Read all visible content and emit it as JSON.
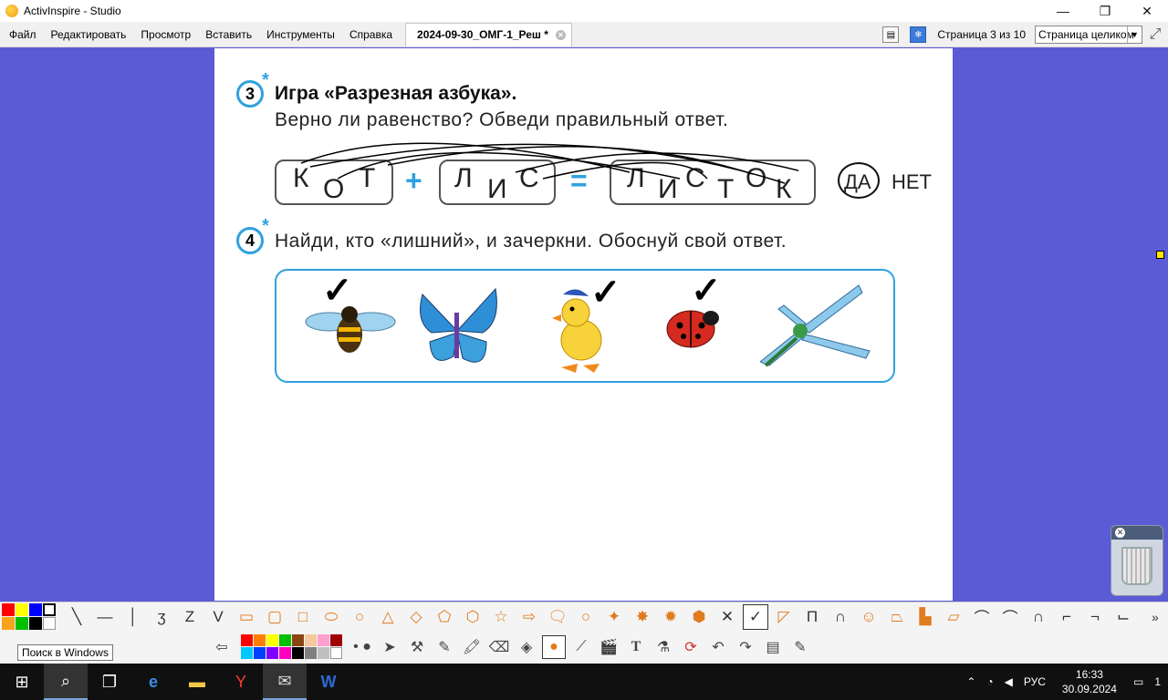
{
  "window": {
    "title": "ActivInspire - Studio"
  },
  "menu": [
    "Файл",
    "Редактировать",
    "Просмотр",
    "Вставить",
    "Инструменты",
    "Справка"
  ],
  "tab": {
    "label": "2024-09-30_ОМГ-1_Реш *"
  },
  "page_counter": "Страница 3 из 10",
  "zoom_select": "Страница целиком",
  "exercise3": {
    "number": "3",
    "title": "Игра «Разрезная азбука».",
    "question": "Верно ли равенство? Обведи правильный ответ.",
    "word1": [
      "К",
      "О",
      "Т"
    ],
    "plus": "+",
    "word2": [
      "Л",
      "И",
      "С"
    ],
    "equals": "=",
    "word3": [
      "Л",
      "И",
      "С",
      "Т",
      "О",
      "К"
    ],
    "yes": "ДА",
    "no": "НЕТ"
  },
  "exercise4": {
    "number": "4",
    "title": "Найди, кто «лишний», и зачеркни. Обоснуй свой ответ.",
    "animals": [
      "bee",
      "butterfly",
      "duckling",
      "ladybug",
      "dragonfly"
    ]
  },
  "tooltip": "Поиск в Windows",
  "tray": {
    "lang": "РУС",
    "time": "16:33",
    "date": "30.09.2024",
    "notifications": "1"
  },
  "colors": {
    "background": "#5b5bd6",
    "accent": "#2fa1e0"
  }
}
